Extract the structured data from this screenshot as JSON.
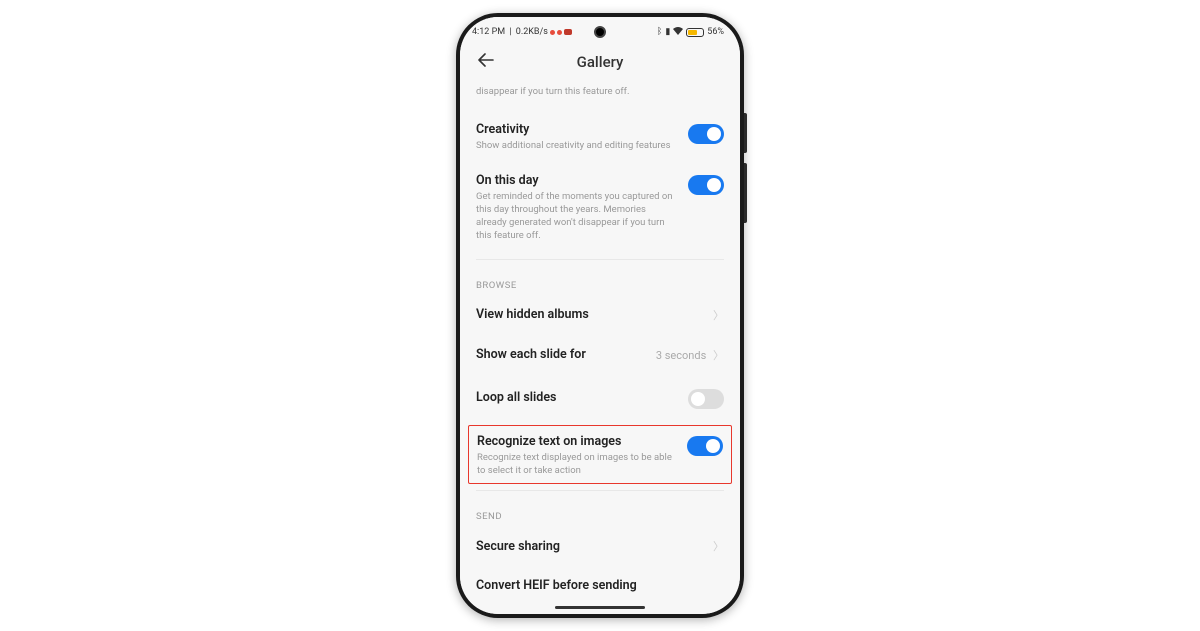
{
  "statusBar": {
    "time": "4:12 PM",
    "speed": "0.2KB/s",
    "batteryText": "56%"
  },
  "header": {
    "title": "Gallery"
  },
  "trailingDesc": "disappear if you turn this feature off.",
  "settings": {
    "creativity": {
      "title": "Creativity",
      "desc": "Show additional creativity and editing features"
    },
    "onThisDay": {
      "title": "On this day",
      "desc": "Get reminded of the moments you captured on this day throughout the years. Memories already generated won't disappear if you turn this feature off."
    }
  },
  "sections": {
    "browse": "Browse",
    "send": "Send"
  },
  "browseItems": {
    "viewHidden": "View hidden albums",
    "showSlide": {
      "title": "Show each slide for",
      "value": "3 seconds"
    },
    "loopSlides": "Loop all slides",
    "recognize": {
      "title": "Recognize text on images",
      "desc": "Recognize text displayed on images to be able to select it or take action"
    }
  },
  "sendItems": {
    "secureSharing": "Secure sharing",
    "convertHeif": "Convert HEIF before sending"
  }
}
